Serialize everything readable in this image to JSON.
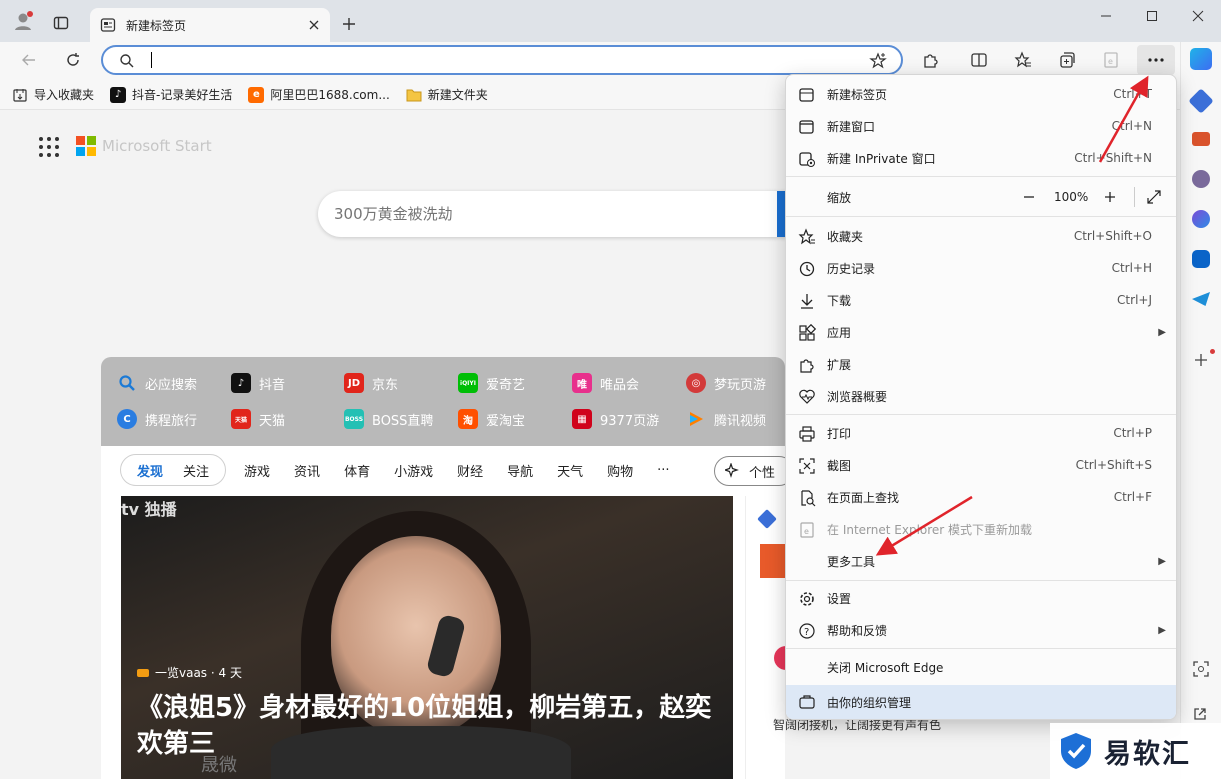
{
  "tab": {
    "title": "新建标签页"
  },
  "address": {
    "value": "",
    "placeholder": ""
  },
  "bookmarks": [
    {
      "label": "导入收藏夹",
      "icon": "import-icon"
    },
    {
      "label": "抖音-记录美好生活",
      "icon": "douyin-icon"
    },
    {
      "label": "阿里巴巴1688.com...",
      "icon": "alibaba-icon"
    },
    {
      "label": "新建文件夹",
      "icon": "folder-icon"
    }
  ],
  "page": {
    "brand": "Microsoft Start",
    "search_placeholder": "300万黄金被洗劫",
    "quicklinks": [
      {
        "label": "必应搜索",
        "color": "#1b7ad6"
      },
      {
        "label": "抖音",
        "color": "#111111"
      },
      {
        "label": "京东",
        "color": "#e1251b"
      },
      {
        "label": "爱奇艺",
        "color": "#00be06"
      },
      {
        "label": "唯品会",
        "color": "#e8308c"
      },
      {
        "label": "梦玩页游",
        "color": "#d33a3a"
      },
      {
        "label": "携程旅行",
        "color": "#2a7de1"
      },
      {
        "label": "天猫",
        "color": "#e1251b"
      },
      {
        "label": "BOSS直聘",
        "color": "#23c0b4"
      },
      {
        "label": "爱淘宝",
        "color": "#ff5000"
      },
      {
        "label": "9377页游",
        "color": "#d0021b"
      },
      {
        "label": "腾讯视频",
        "color": "#ff7f00"
      }
    ],
    "feed_pill": [
      "发现",
      "关注"
    ],
    "feed_tabs": [
      "游戏",
      "资讯",
      "体育",
      "小游戏",
      "财经",
      "导航",
      "天气",
      "购物",
      "···"
    ],
    "personalize": "个性",
    "hero": {
      "logo": "tv 独播",
      "source": "一览vaas · 4 天",
      "title": "《浪姐5》身材最好的10位姐姐，柳岩第五，赵奕欢第三",
      "caption": "晟微"
    },
    "side_snippet": "智阔闭接机，让阔接更有声有色"
  },
  "menu": {
    "items": [
      {
        "label": "新建标签页",
        "shortcut": "Ctrl+T",
        "icon": "new-tab-icon"
      },
      {
        "label": "新建窗口",
        "shortcut": "Ctrl+N",
        "icon": "new-window-icon"
      },
      {
        "label": "新建 InPrivate 窗口",
        "shortcut": "Ctrl+Shift+N",
        "icon": "inprivate-icon"
      },
      {
        "label": "缩放",
        "zoom": "100%",
        "icon": ""
      },
      {
        "label": "收藏夹",
        "shortcut": "Ctrl+Shift+O",
        "icon": "favorites-icon"
      },
      {
        "label": "历史记录",
        "shortcut": "Ctrl+H",
        "icon": "history-icon"
      },
      {
        "label": "下载",
        "shortcut": "Ctrl+J",
        "icon": "download-icon"
      },
      {
        "label": "应用",
        "shortcut": "",
        "icon": "apps-icon"
      },
      {
        "label": "扩展",
        "shortcut": "",
        "icon": "extensions-icon"
      },
      {
        "label": "浏览器概要",
        "shortcut": "",
        "icon": "essentials-icon"
      },
      {
        "label": "打印",
        "shortcut": "Ctrl+P",
        "icon": "print-icon"
      },
      {
        "label": "截图",
        "shortcut": "Ctrl+Shift+S",
        "icon": "screenshot-icon"
      },
      {
        "label": "在页面上查找",
        "shortcut": "Ctrl+F",
        "icon": "find-icon"
      },
      {
        "label": "在 Internet Explorer 模式下重新加载",
        "shortcut": "",
        "icon": "ie-mode-icon"
      },
      {
        "label": "更多工具",
        "shortcut": "",
        "icon": ""
      },
      {
        "label": "设置",
        "shortcut": "",
        "icon": "settings-icon"
      },
      {
        "label": "帮助和反馈",
        "shortcut": "",
        "icon": "help-icon"
      },
      {
        "label": "关闭 Microsoft Edge",
        "shortcut": "",
        "icon": ""
      },
      {
        "label": "由你的组织管理",
        "shortcut": "",
        "icon": "briefcase-icon"
      }
    ]
  },
  "watermark": {
    "text": "易软汇"
  },
  "colors": {
    "accent": "#1a6fd1",
    "arrow": "#e0242b",
    "menu_highlight": "#dde8f6"
  }
}
